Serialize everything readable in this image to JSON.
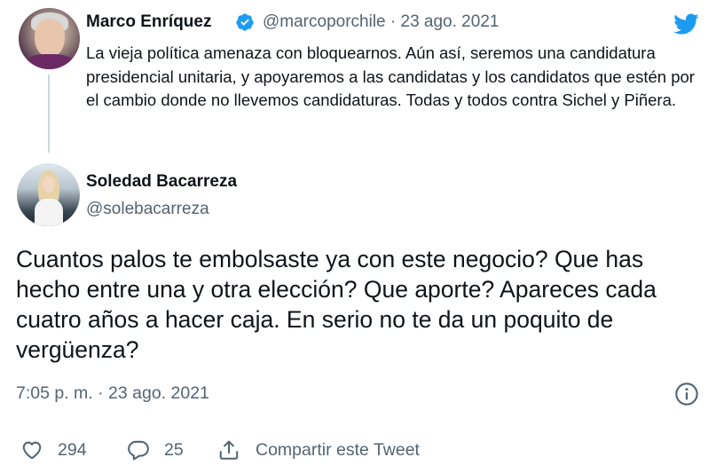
{
  "parent_tweet": {
    "name": "Marco Enríquez",
    "handle": "@marcoporchile",
    "date_sep": "·",
    "date": "23 ago. 2021",
    "text": "La vieja política amenaza con bloquearnos. Aún así, seremos una candidatura presidencial unitaria, y apoyaremos a las candidatas y los candidatos que estén por el cambio donde no llevemos candidaturas. Todas y todos contra Sichel y Piñera."
  },
  "reply_tweet": {
    "name": "Soledad Bacarreza",
    "handle": "@solebacarreza",
    "text": "Cuantos palos te embolsaste ya con este negocio? Que has hecho entre una y otra elección? Que aporte? Apareces cada cuatro años a hacer caja. En serio no te da un poquito de vergüenza?",
    "timestamp": "7:05 p. m. · 23 ago. 2021"
  },
  "actions": {
    "like_count": "294",
    "reply_count": "25",
    "share_label": "Compartir este Tweet"
  },
  "icons": {
    "verified": "verified-badge-icon",
    "brand": "twitter-bird-icon",
    "info": "info-icon",
    "like": "heart-icon",
    "reply": "reply-bubble-icon",
    "share": "share-icon"
  },
  "colors": {
    "brand": "#1d9bf0",
    "text": "#0f1419",
    "secondary": "#536471",
    "thread_line": "#cfd9de"
  }
}
